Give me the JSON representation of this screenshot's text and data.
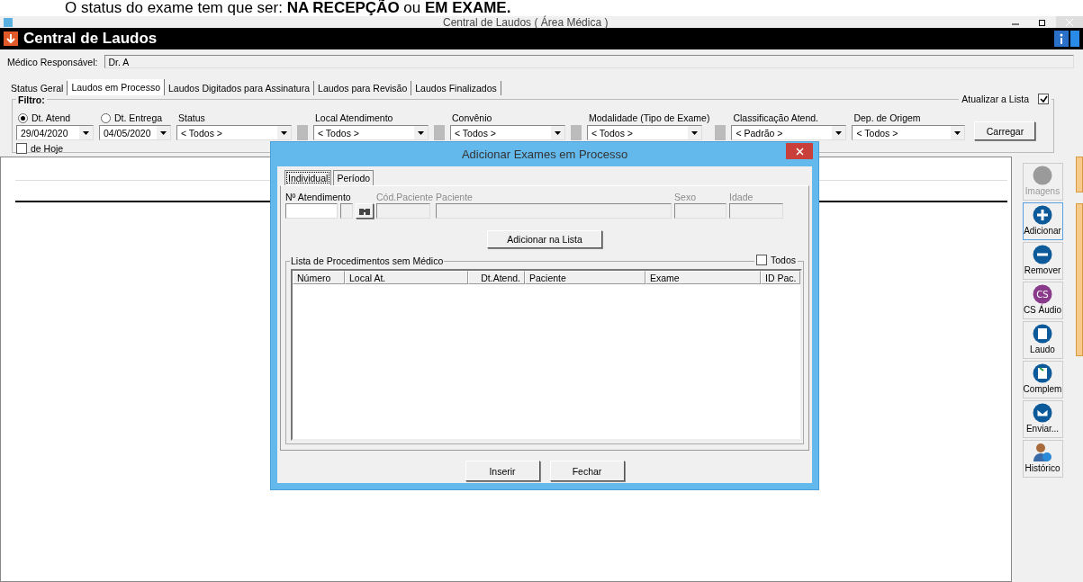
{
  "banner": {
    "text": "O status do exame tem que ser: **NA RECEPÇÃO** ou **EM EXAME.**"
  },
  "window": {
    "title": "Central de Laudos ( Área Médica )"
  },
  "header": {
    "title": "Central de Laudos"
  },
  "doctor": {
    "label": "Médico Responsável:",
    "value": "Dr. A"
  },
  "tabs": [
    {
      "label": "Status Geral",
      "selected": false
    },
    {
      "label": "Laudos em Processo",
      "selected": true
    },
    {
      "label": "Laudos Digitados para Assinatura",
      "selected": false
    },
    {
      "label": "Laudos para Revisão",
      "selected": false
    },
    {
      "label": "Laudos Finalizados",
      "selected": false
    }
  ],
  "filter": {
    "title": "Filtro:",
    "date_modes": [
      {
        "label": "Dt. Atend",
        "selected": true,
        "value": "29/04/2020"
      },
      {
        "label": "Dt. Entrega",
        "selected": false,
        "value": "04/05/2020"
      }
    ],
    "combos": [
      {
        "label": "Status",
        "value": "< Todos >",
        "picker": true
      },
      {
        "label": "Local Atendimento",
        "value": "< Todos >",
        "picker": true
      },
      {
        "label": "Convênio",
        "value": "< Todos >",
        "picker": true
      },
      {
        "label": "Modalidade (Tipo de Exame)",
        "value": "< Todos >",
        "picker": true
      },
      {
        "label": "Classificação Atend.",
        "value": "< Padrão >",
        "picker": false
      },
      {
        "label": "Dep. de Origem",
        "value": "< Todos >",
        "picker": false
      }
    ],
    "today": {
      "label": "de Hoje",
      "checked": false
    },
    "refresh": {
      "label": "Atualizar a Lista",
      "checked": true
    },
    "load_button": "Carregar"
  },
  "toolbar": [
    {
      "kind": "images",
      "label": "Imagens",
      "disabled": true,
      "selected": false
    },
    {
      "kind": "add",
      "label": "Adicionar",
      "disabled": false,
      "selected": true
    },
    {
      "kind": "remove",
      "label": "Remover",
      "disabled": false,
      "selected": false
    },
    {
      "kind": "audio",
      "label": "CS Áudio",
      "icon_text": "CS",
      "disabled": false,
      "selected": false
    },
    {
      "kind": "report",
      "label": "Laudo",
      "disabled": false,
      "selected": false
    },
    {
      "kind": "complement",
      "label": "Complem",
      "disabled": false,
      "selected": false
    },
    {
      "kind": "send",
      "label": "Enviar...",
      "disabled": false,
      "selected": false
    },
    {
      "kind": "history",
      "label": "Histórico",
      "disabled": false,
      "selected": false
    }
  ],
  "dialog": {
    "title": "Adicionar Exames em Processo",
    "tabs": [
      {
        "label": "Individual",
        "selected": true
      },
      {
        "label": "Período",
        "selected": false
      }
    ],
    "fields": [
      {
        "label": "Nº Atendimento",
        "disabled": false
      },
      {
        "label": "Cód.Paciente",
        "disabled": true
      },
      {
        "label": "Paciente",
        "disabled": true
      },
      {
        "label": "Sexo",
        "disabled": true
      },
      {
        "label": "Idade",
        "disabled": true
      }
    ],
    "add_button": "Adicionar na Lista",
    "list": {
      "title": "Lista de Procedimentos sem Médico",
      "all": {
        "label": "Todos",
        "checked": false
      },
      "columns": [
        "Número",
        "Local At.",
        "Dt.Atend.",
        "Paciente",
        "Exame",
        "ID Pac."
      ]
    },
    "buttons": [
      "Inserir",
      "Fechar"
    ]
  }
}
